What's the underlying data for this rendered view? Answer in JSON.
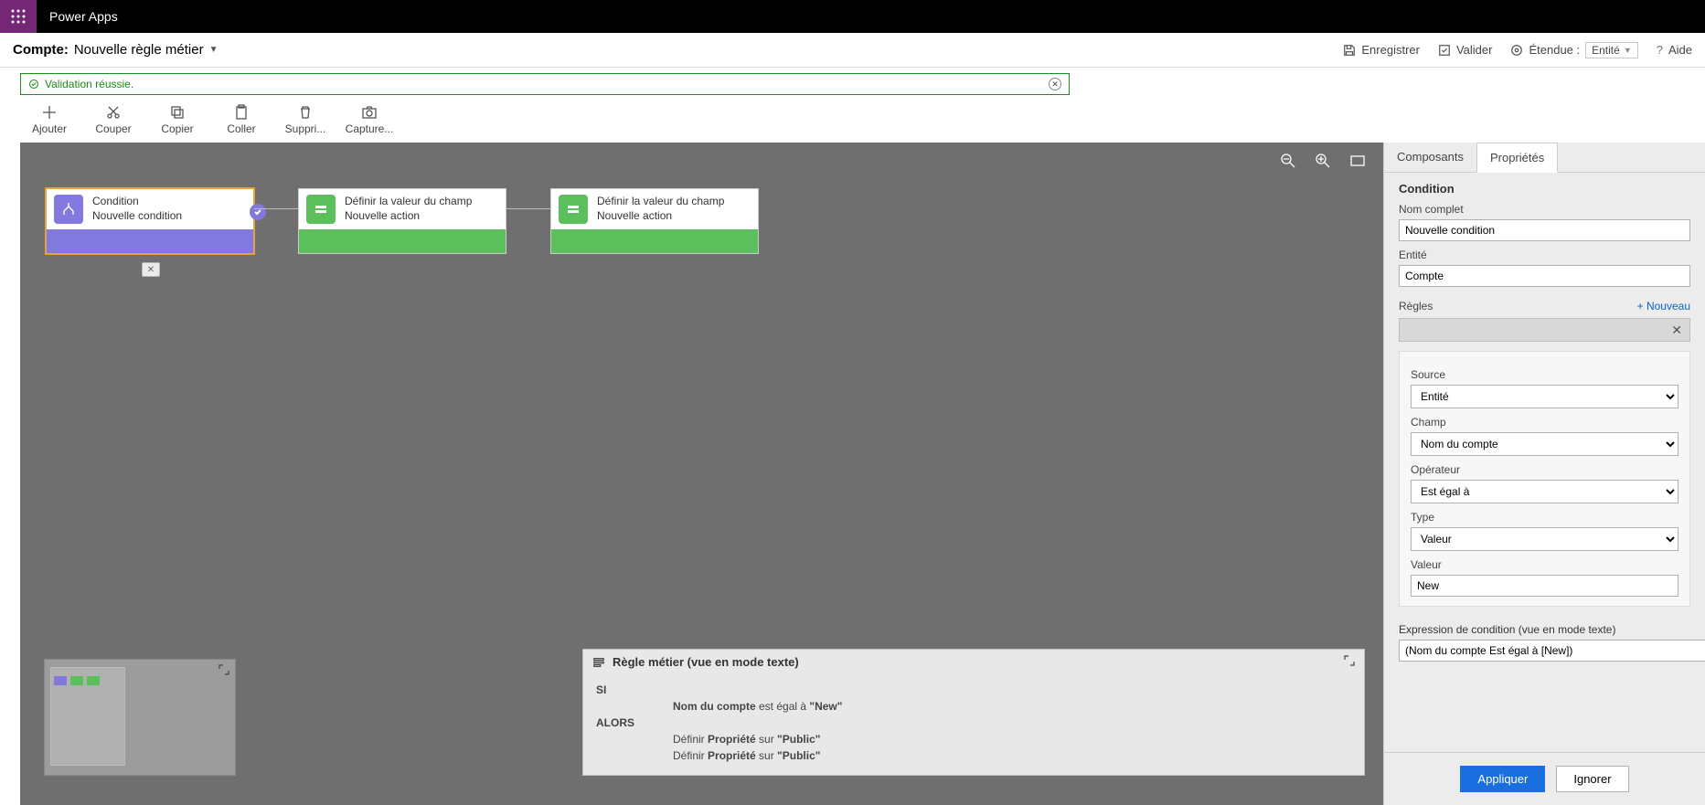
{
  "app_title": "Power Apps",
  "breadcrumb": {
    "prefix": "Compte:",
    "title": "Nouvelle règle métier"
  },
  "top_actions": {
    "save": "Enregistrer",
    "validate": "Valider",
    "scope": "Étendue :",
    "scope_value": "Entité",
    "help": "Aide"
  },
  "banner": "Validation réussie.",
  "toolbar": [
    {
      "id": "add",
      "label": "Ajouter"
    },
    {
      "id": "cut",
      "label": "Couper"
    },
    {
      "id": "copy",
      "label": "Copier"
    },
    {
      "id": "paste",
      "label": "Coller"
    },
    {
      "id": "delete",
      "label": "Suppri..."
    },
    {
      "id": "snapshot",
      "label": "Capture..."
    }
  ],
  "nodes": {
    "condition": {
      "title": "Condition",
      "sub": "Nouvelle condition"
    },
    "action1": {
      "title": "Définir la valeur du champ",
      "sub": "Nouvelle action"
    },
    "action2": {
      "title": "Définir la valeur du champ",
      "sub": "Nouvelle action"
    }
  },
  "textview": {
    "title": "Règle métier (vue en mode texte)",
    "if": "SI",
    "then": "ALORS",
    "if_line": "Nom du compte est égal à \"New\"",
    "then_1": "Définir Propriété sur \"Public\"",
    "then_2": "Définir Propriété sur \"Public\""
  },
  "tabs": {
    "components": "Composants",
    "properties": "Propriétés"
  },
  "props": {
    "title": "Condition",
    "display_name_label": "Nom complet",
    "display_name": "Nouvelle condition",
    "entity_label": "Entité",
    "entity": "Compte",
    "rules_label": "Règles",
    "new": "+ Nouveau",
    "source_label": "Source",
    "source": "Entité",
    "field_label": "Champ",
    "field": "Nom du compte",
    "operator_label": "Opérateur",
    "operator": "Est égal à",
    "type_label": "Type",
    "type": "Valeur",
    "value_label": "Valeur",
    "value": "New",
    "expr_label": "Expression de condition (vue en mode texte)",
    "expr": "(Nom du compte Est égal à [New])",
    "apply": "Appliquer",
    "discard": "Ignorer"
  }
}
